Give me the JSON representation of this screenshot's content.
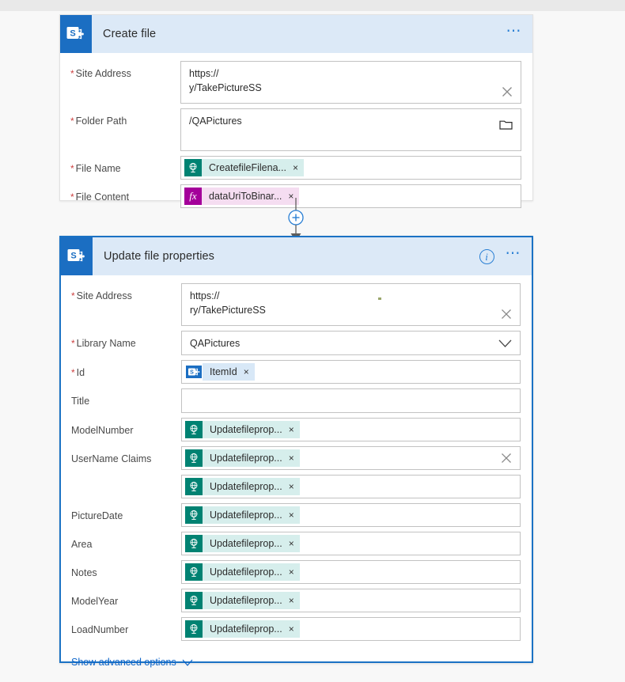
{
  "cards": [
    {
      "id": "create-file",
      "title": "Create file",
      "connector_icon": "plus-circle-icon",
      "logo_icon": "sharepoint-icon",
      "more_icon": "ellipsis-icon",
      "fields": [
        {
          "label": "Site Address",
          "required": true,
          "type": "two-line-text",
          "line1": "https://",
          "line2": "y/TakePictureSS",
          "trailing_icon": "clear-x-icon"
        },
        {
          "label": "Folder Path",
          "required": true,
          "type": "text-tall",
          "value": "/QAPictures",
          "trailing_icon": "folder-icon"
        },
        {
          "label": "File Name",
          "required": true,
          "type": "token",
          "token": {
            "text": "CreatefileFilena...",
            "icon": "dynamic-content-icon",
            "color": "teal",
            "remove": "×"
          }
        },
        {
          "label": "File Content",
          "required": true,
          "type": "token",
          "token": {
            "text": "dataUriToBinar...",
            "icon": "function-fx-icon",
            "color": "magenta",
            "remove": "×",
            "glyph": "fx"
          }
        }
      ]
    },
    {
      "id": "update-file-properties",
      "title": "Update file properties",
      "logo_icon": "sharepoint-icon",
      "info_icon": "info-icon",
      "more_icon": "ellipsis-icon",
      "selected": true,
      "fields": [
        {
          "label": "Site Address",
          "required": true,
          "type": "two-line-text",
          "line1": "https://",
          "line2": "ry/TakePictureSS",
          "trailing_icon": "clear-x-icon"
        },
        {
          "label": "Library Name",
          "required": true,
          "type": "dropdown",
          "value": "QAPictures",
          "trailing_icon": "chevron-down-icon"
        },
        {
          "label": "Id",
          "required": true,
          "type": "token",
          "token": {
            "text": "ItemId",
            "icon": "sharepoint-icon",
            "color": "spblue",
            "remove": "×"
          }
        },
        {
          "label": "Title",
          "required": false,
          "type": "text",
          "value": ""
        },
        {
          "label": "ModelNumber",
          "required": false,
          "type": "token",
          "token": {
            "text": "Updatefileprop...",
            "icon": "dynamic-content-icon",
            "color": "teal",
            "remove": "×"
          }
        },
        {
          "label": "UserName Claims",
          "required": false,
          "type": "token",
          "trailing_icon": "clear-x-icon",
          "token": {
            "text": "Updatefileprop...",
            "icon": "dynamic-content-icon",
            "color": "teal",
            "remove": "×"
          }
        },
        {
          "label": "",
          "required": false,
          "type": "token",
          "token": {
            "text": "Updatefileprop...",
            "icon": "dynamic-content-icon",
            "color": "teal",
            "remove": "×"
          }
        },
        {
          "label": "PictureDate",
          "required": false,
          "type": "token",
          "token": {
            "text": "Updatefileprop...",
            "icon": "dynamic-content-icon",
            "color": "teal",
            "remove": "×"
          }
        },
        {
          "label": "Area",
          "required": false,
          "type": "token",
          "token": {
            "text": "Updatefileprop...",
            "icon": "dynamic-content-icon",
            "color": "teal",
            "remove": "×"
          }
        },
        {
          "label": "Notes",
          "required": false,
          "type": "token",
          "token": {
            "text": "Updatefileprop...",
            "icon": "dynamic-content-icon",
            "color": "teal",
            "remove": "×"
          }
        },
        {
          "label": "ModelYear",
          "required": false,
          "type": "token",
          "token": {
            "text": "Updatefileprop...",
            "icon": "dynamic-content-icon",
            "color": "teal",
            "remove": "×"
          }
        },
        {
          "label": "LoadNumber",
          "required": false,
          "type": "token",
          "token": {
            "text": "Updatefileprop...",
            "icon": "dynamic-content-icon",
            "color": "teal",
            "remove": "×"
          }
        }
      ],
      "advanced_link": "Show advanced options",
      "advanced_icon": "chevron-down-icon"
    }
  ],
  "colors": {
    "sharepoint_blue": "#1b6ec2",
    "header_blue": "#dce9f7",
    "selected_border": "#1b72c4",
    "token_teal": "#008272",
    "token_magenta": "#a4009a",
    "link_blue": "#0a63c9",
    "required_red": "#cc3f3f",
    "canvas": "#f8f8f8"
  }
}
